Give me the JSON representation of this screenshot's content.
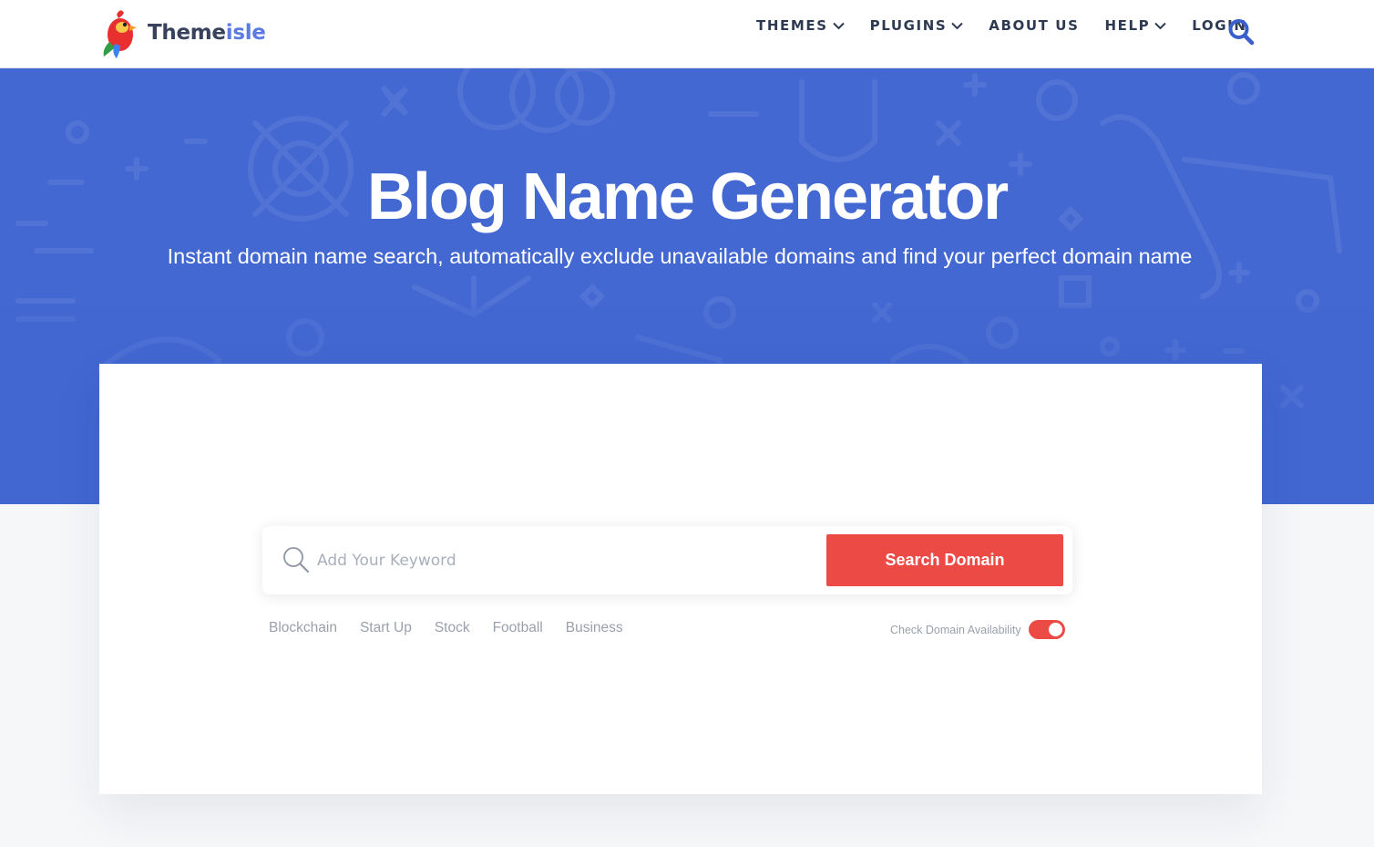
{
  "brand": {
    "name_part1": "Theme",
    "name_part2": "isle"
  },
  "nav": {
    "items": [
      {
        "label": "THEMES",
        "has_dropdown": true
      },
      {
        "label": "PLUGINS",
        "has_dropdown": true
      },
      {
        "label": "ABOUT US",
        "has_dropdown": false
      },
      {
        "label": "HELP",
        "has_dropdown": true
      },
      {
        "label": "LOGIN",
        "has_dropdown": false
      }
    ],
    "search_icon": "search-icon"
  },
  "hero": {
    "title": "Blog Name Generator",
    "subtitle": "Instant domain name search, automatically exclude unavailable domains and find your perfect domain name"
  },
  "search": {
    "placeholder": "Add Your Keyword",
    "value": "",
    "button_label": "Search Domain"
  },
  "tags": [
    "Blockchain",
    "Start Up",
    "Stock",
    "Football",
    "Business"
  ],
  "availability": {
    "label": "Check Domain Availability",
    "enabled": true
  },
  "colors": {
    "hero_blue": "#4368d1",
    "accent_red": "#ec4b45",
    "nav_text": "#2e3a52",
    "brand_blue": "#5b7be3"
  }
}
